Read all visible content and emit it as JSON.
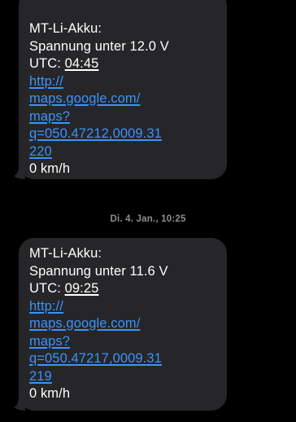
{
  "messages": [
    {
      "title": "MT-Li-Akku:",
      "voltage_line": "Spannung unter 12.0 V",
      "utc_label": "UTC: ",
      "utc_time": "04:45",
      "link_lines": [
        "http://",
        "maps.google.com/",
        "maps?",
        "q=050.47212,0009.31",
        "220"
      ],
      "speed": "0 km/h"
    },
    {
      "title": "MT-Li-Akku:",
      "voltage_line": "Spannung unter 11.6 V",
      "utc_label": "UTC: ",
      "utc_time": "09:25",
      "link_lines": [
        "http://",
        "maps.google.com/",
        "maps?",
        "q=050.47217,0009.31",
        "219"
      ],
      "speed": "0 km/h"
    }
  ],
  "timestamp": "Di. 4. Jan., 10:25",
  "colors": {
    "background": "#000000",
    "bubble": "#262628",
    "text": "#ffffff",
    "link": "#3a93ff",
    "timestamp": "#8d8d93"
  }
}
